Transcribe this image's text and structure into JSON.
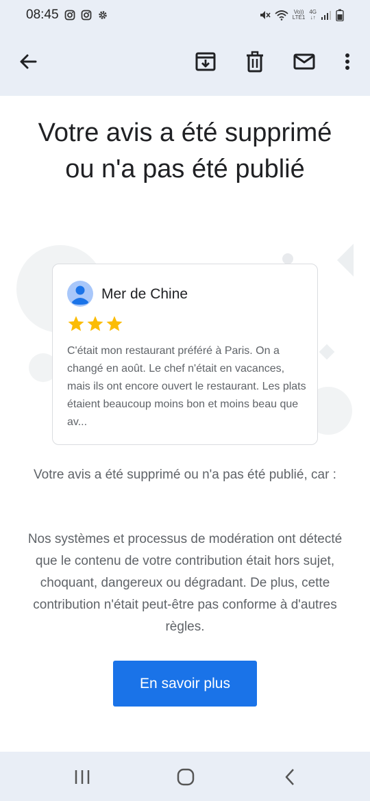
{
  "status_bar": {
    "time": "08:45",
    "network_label_top": "Vo))",
    "network_label_bottom": "LTE1",
    "signal_label": "4G",
    "notification_icons": [
      "instagram-icon",
      "instagram-icon",
      "settings-gear-icon"
    ],
    "system_icons": [
      "mute-icon",
      "wifi-icon",
      "signal-icon",
      "battery-icon"
    ]
  },
  "toolbar": {
    "icons": [
      "back-arrow-icon",
      "archive-icon",
      "delete-icon",
      "mark-unread-icon",
      "more-vert-icon"
    ]
  },
  "email": {
    "title": "Votre avis a été supprimé ou n'a pas été publié",
    "review": {
      "place_name": "Mer de Chine",
      "rating": 3,
      "text": "C'était mon restaurant préféré à Paris. On a changé en août. Le chef n'était en vacances, mais ils ont encore ouvert le restaurant. Les plats étaient beaucoup moins bon et moins beau que av..."
    },
    "reason_intro": "Votre avis a été supprimé ou n'a pas été publié, car :",
    "reason_details": "Nos systèmes et processus de modération ont détecté que le contenu de votre contribution était hors sujet, choquant, dangereux ou dégradant. De plus, cette contribution n'était peut-être pas conforme à d'autres règles.",
    "cta_label": "En savoir plus"
  },
  "colors": {
    "accent": "#1a73e8",
    "star": "#fbbc04",
    "bar_background": "#e9eef6"
  },
  "nav_bar": {
    "icons": [
      "recents-icon",
      "home-icon",
      "back-icon"
    ]
  }
}
